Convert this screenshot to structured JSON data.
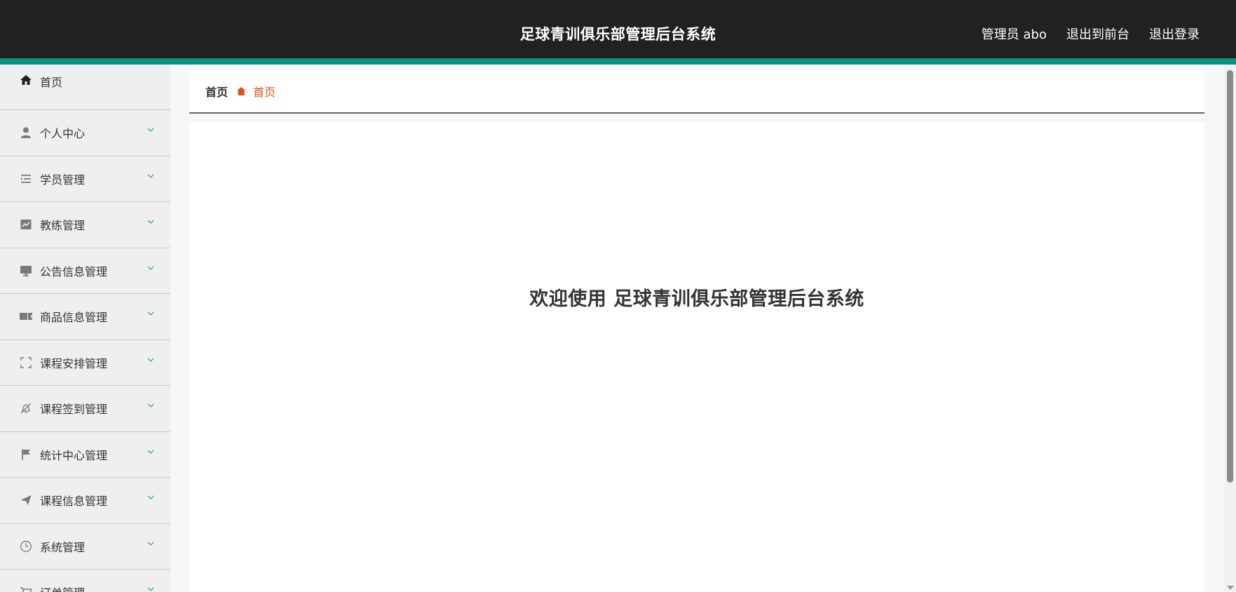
{
  "header": {
    "title": "足球青训俱乐部管理后台系统",
    "user_label": "管理员 abo",
    "front_link": "退出到前台",
    "logout_link": "退出登录"
  },
  "sidebar": {
    "items": [
      {
        "label": "首页",
        "icon": "home-icon"
      },
      {
        "label": "个人中心",
        "icon": "user-icon"
      },
      {
        "label": "学员管理",
        "icon": "list-icon"
      },
      {
        "label": "教练管理",
        "icon": "chart-icon"
      },
      {
        "label": "公告信息管理",
        "icon": "monitor-icon"
      },
      {
        "label": "商品信息管理",
        "icon": "ticket-icon"
      },
      {
        "label": "课程安排管理",
        "icon": "fullscreen-icon"
      },
      {
        "label": "课程签到管理",
        "icon": "bell-off-icon"
      },
      {
        "label": "统计中心管理",
        "icon": "flag-icon"
      },
      {
        "label": "课程信息管理",
        "icon": "send-icon"
      },
      {
        "label": "系统管理",
        "icon": "clock-icon"
      },
      {
        "label": "订单管理",
        "icon": "cart-icon"
      }
    ]
  },
  "breadcrumb": {
    "home": "首页",
    "current": "首页"
  },
  "main": {
    "welcome": "欢迎使用 足球青训俱乐部管理后台系统"
  },
  "colors": {
    "header_bg": "#212121",
    "accent": "#0f8f85",
    "breadcrumb_active": "#e2511a"
  }
}
